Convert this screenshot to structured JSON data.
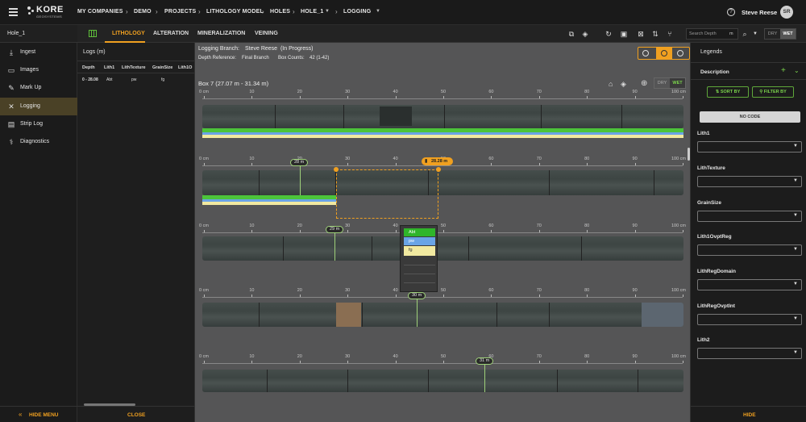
{
  "app": {
    "brand": "KORE",
    "brand_sub": "GEOSYSTEMS",
    "user_name": "Steve Reese",
    "user_initials": "SR"
  },
  "breadcrumb": [
    "MY COMPANIES",
    "DEMO",
    "PROJECTS",
    "LITHOLOGY MODEL",
    "HOLES",
    "HOLE_1",
    "LOGGING"
  ],
  "search": {
    "placeholder": "Search Depth",
    "unit": "m"
  },
  "sidebar": {
    "hole": "Hole_1",
    "items": [
      {
        "label": "Ingest"
      },
      {
        "label": "Images"
      },
      {
        "label": "Mark Up"
      },
      {
        "label": "Logging"
      },
      {
        "label": "Strip Log"
      },
      {
        "label": "Diagnostics"
      }
    ],
    "hide_menu": "HIDE MENU"
  },
  "tabs": [
    "LITHOLOGY",
    "ALTERATION",
    "MINERALIZATION",
    "VEINING"
  ],
  "toggle": {
    "dry": "DRY",
    "wet": "WET"
  },
  "logs": {
    "title": "Logs (m)",
    "columns": [
      "Depth",
      "Lith1",
      "LithTexture",
      "GrainSize",
      "Lith1O"
    ],
    "row": [
      "0 - 28.08",
      "Abt",
      "pw",
      "fg"
    ],
    "close": "CLOSE"
  },
  "center": {
    "branch_label": "Logging Branch:",
    "branch_value": "Steve Reese  (In Progress)",
    "depth_ref_label": "Depth Reference:",
    "depth_ref_value": "Final Branch",
    "box_counts_label": "Box Counts:",
    "box_counts_value": "42 (1-42)",
    "box_title": "Box 7 (27.07 m - 31.34 m)"
  },
  "ruler_ticks": [
    "0 cm",
    "10",
    "20",
    "30",
    "40",
    "50",
    "60",
    "70",
    "80",
    "90",
    "100 cm"
  ],
  "markers": [
    "28 m",
    "28.28 m",
    "29 m",
    "30 m",
    "31 m"
  ],
  "dropdown": [
    "Abt",
    "pw",
    "fg"
  ],
  "legends": {
    "title": "Legends",
    "description": "Description",
    "sort_by": "SORT BY",
    "filter_by": "FILTER BY",
    "no_code": "NO CODE",
    "fields": [
      "Lith1",
      "LithTexture",
      "GrainSize",
      "Lith1OvptReg",
      "LithRegDomain",
      "LithRegOvptInt",
      "Lith2"
    ],
    "hide": "HIDE"
  },
  "colors": {
    "accent": "#f0a020",
    "green": "#4cc43a",
    "blue_select": "#6aa4e6",
    "yellow_select": "#f2e9a0"
  }
}
